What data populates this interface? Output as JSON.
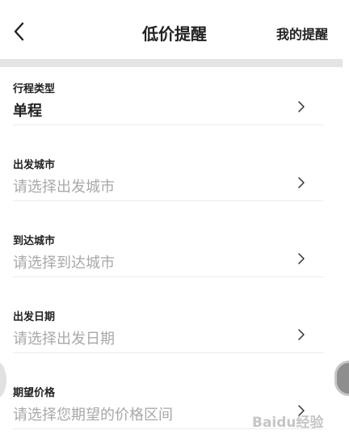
{
  "header": {
    "title": "低价提醒",
    "right_link": "我的提醒",
    "back_icon": "chevron-left-icon"
  },
  "form": {
    "rows": [
      {
        "label": "行程类型",
        "value": "单程",
        "filled": true
      },
      {
        "label": "出发城市",
        "value": "请选择出发城市",
        "filled": false
      },
      {
        "label": "到达城市",
        "value": "请选择到达城市",
        "filled": false
      },
      {
        "label": "出发日期",
        "value": "请选择出发日期",
        "filled": false
      },
      {
        "label": "期望价格",
        "value": "请选择您期望的价格区间",
        "filled": false
      }
    ],
    "row_icon": "chevron-right-icon"
  },
  "watermark": "Baidu经验",
  "colors": {
    "text": "#222222",
    "placeholder": "#a8a8a8",
    "divider_bar": "#e4e4e4",
    "separator": "#ececec"
  }
}
